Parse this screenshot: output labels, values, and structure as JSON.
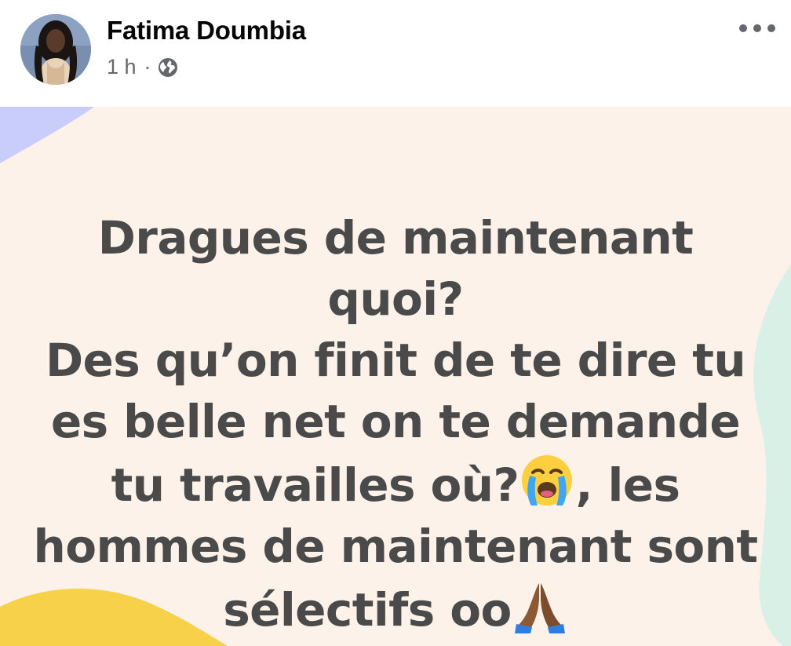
{
  "post": {
    "author_name": "Fatima Doumbia",
    "timestamp": "1 h",
    "separator": "·",
    "audience_icon": "globe-icon",
    "more_icon": "more-options-icon",
    "text_parts": [
      "Dragues de maintenant quoi?",
      "Des qu’on finit de te dire tu es belle net on te demande tu travailles où?",
      ", les hommes de maintenant sont sélectifs oo"
    ],
    "emojis": [
      "loudly-crying-face-emoji",
      "folded-hands-emoji"
    ],
    "background_color": "#fdf2e9",
    "text_color": "#4a4a4a"
  }
}
